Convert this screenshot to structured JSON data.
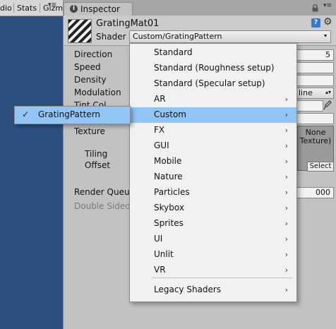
{
  "game_toolbar": {
    "tabs": [
      "dio",
      "Stats",
      "Gizm"
    ]
  },
  "inspector": {
    "tab_label": "Inspector",
    "material_name": "GratingMat01",
    "shader_label": "Shader",
    "shader_value": "Custom/GratingPattern",
    "properties": {
      "direction": {
        "label": "Direction",
        "value": "5"
      },
      "speed": {
        "label": "Speed",
        "value": ""
      },
      "density": {
        "label": "Density",
        "value": ""
      },
      "modulation": {
        "label": "Modulation",
        "value": "line"
      },
      "tint_color": {
        "label": "Tint Col"
      },
      "texture": {
        "label": "Texture",
        "slot_text": "None\nTexture)",
        "select_label": "Select"
      },
      "tiling": {
        "label": "Tiling"
      },
      "offset": {
        "label": "Offset"
      },
      "render_queue": {
        "label": "Render Queue",
        "value": "000"
      },
      "double_sided": {
        "label": "Double Sided"
      }
    }
  },
  "shader_menu": {
    "items": [
      {
        "label": "Standard",
        "submenu": false
      },
      {
        "label": "Standard (Roughness setup)",
        "submenu": false
      },
      {
        "label": "Standard (Specular setup)",
        "submenu": false
      },
      {
        "label": "AR",
        "submenu": true
      },
      {
        "label": "Custom",
        "submenu": true,
        "active": true
      },
      {
        "label": "FX",
        "submenu": true
      },
      {
        "label": "GUI",
        "submenu": true
      },
      {
        "label": "Mobile",
        "submenu": true
      },
      {
        "label": "Nature",
        "submenu": true
      },
      {
        "label": "Particles",
        "submenu": true
      },
      {
        "label": "Skybox",
        "submenu": true
      },
      {
        "label": "Sprites",
        "submenu": true
      },
      {
        "label": "UI",
        "submenu": true
      },
      {
        "label": "Unlit",
        "submenu": true
      },
      {
        "label": "VR",
        "submenu": true
      }
    ],
    "footer_item": {
      "label": "Legacy Shaders",
      "submenu": true
    }
  },
  "custom_submenu": {
    "items": [
      {
        "label": "GratingPattern",
        "checked": true
      }
    ]
  },
  "glyphs": {
    "arrow": "›",
    "check": "✓",
    "caret": "▾",
    "menu": "▾≡"
  },
  "colors": {
    "highlight": "#92c5f5",
    "scene_bg": "#2d4f7f",
    "panel_bg": "#c2c2c2"
  }
}
